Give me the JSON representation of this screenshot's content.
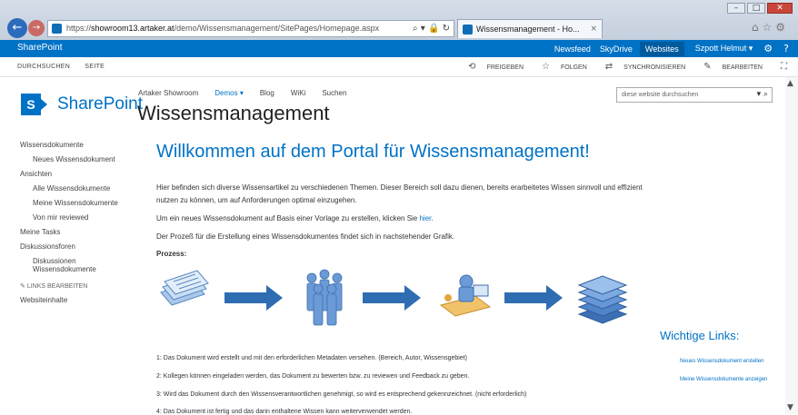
{
  "browser": {
    "address_prefix": "https://",
    "address_host": "showroom13.artaker.at",
    "address_path": "/demo/Wissensmanagement/SitePages/Homepage.aspx",
    "tab_title": "Wissensmanagement - Ho...",
    "tab_close": "×"
  },
  "suitebar": {
    "brand": "SharePoint",
    "links": [
      "Newsfeed",
      "SkyDrive",
      "Websites"
    ],
    "active": "Websites",
    "user": "Szpott Helmut ▾",
    "settings_icon": "gear-icon",
    "help_icon": "help-icon"
  },
  "ribbon": {
    "left": [
      "DURCHSUCHEN",
      "SEITE"
    ],
    "share": "FREIGEBEN",
    "follow": "FOLGEN",
    "sync": "SYNCHRONISIEREN",
    "edit": "BEARBEITEN"
  },
  "header": {
    "logo_letter": "S",
    "logo_text": "SharePoint",
    "nav": [
      "Artaker Showroom",
      "Demos",
      "Blog",
      "WiKi",
      "Suchen"
    ],
    "nav_selected": "Demos",
    "site_title": "Wissensmanagement",
    "search_placeholder": "diese website durchsuchen"
  },
  "leftnav": {
    "wissensdokumente": "Wissensdokumente",
    "neues": "Neues Wissensdokument",
    "ansichten": "Ansichten",
    "alle": "Alle Wissensdokumente",
    "meine": "Meine Wissensdokumente",
    "reviewed": "Von mir reviewed",
    "tasks": "Meine Tasks",
    "diskussionsforen": "Diskussionsforen",
    "diskussionen": "Diskussionen Wissensdokumente",
    "edit_links": "LINKS BEARBEITEN",
    "websiteinhalte": "Websiteinhalte"
  },
  "content": {
    "welcome": "Willkommen auf dem Portal für Wissensmanagement!",
    "p1": "Hier befinden sich diverse Wissensartikel zu verschiedenen Themen. Dieser Bereich soll dazu dienen, bereits erarbeitetes Wissen sinnvoll und effizient nutzen zu können, um auf Anforderungen optimal einzugehen.",
    "p2_text": "Um ein neues Wissensdokument auf Basis einer Vorlage zu erstellen, klicken Sie ",
    "p2_link": "hier",
    "p2_end": ".",
    "p3": "Der Prozeß für die Erstellung eines Wissensdokumentes findet sich in nachstehender Grafik.",
    "prozess": "Prozess:",
    "steps": [
      "1: Das Dokument wird erstellt und mit den erforderlichen Metadaten versehen. (Bereich, Autor, Wissensgebiet)",
      "2: Kollegen können eingeladen werden, das Dokument zu bewerten bzw. zu reviewen und Feedback zu geben.",
      "3: Wird das Dokument durch den Wissensverantwortlichen genehmigt, so wird es entsprechend gekennzeichnet. (nicht erforderlich)",
      "4: Das Dokument ist fertig und das darin enthaltene Wissen kann weiterverwendet werden."
    ]
  },
  "wichtige_links": {
    "title": "Wichtige Links:",
    "links": [
      "Neues Wissensdokument erstellen",
      "Meine Wissensdokumente anzeigen"
    ]
  },
  "colors": {
    "suitebar": "#0072c6",
    "accent": "#0072c6"
  }
}
